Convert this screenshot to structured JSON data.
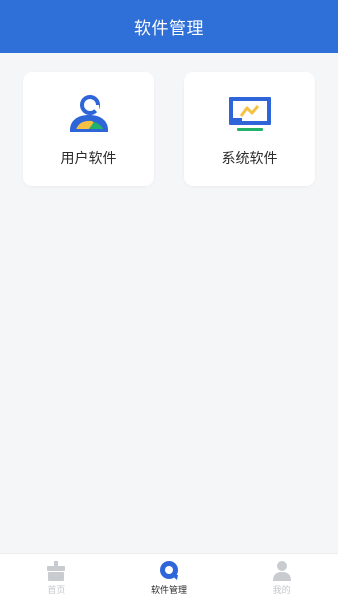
{
  "header": {
    "title": "软件管理"
  },
  "cards": [
    {
      "label": "用户软件",
      "icon": "user-software-icon"
    },
    {
      "label": "系统软件",
      "icon": "system-software-icon"
    }
  ],
  "bottom_nav": {
    "items": [
      {
        "label": "首页",
        "icon": "home-icon",
        "active": false
      },
      {
        "label": "软件管理",
        "icon": "software-management-icon",
        "active": true
      },
      {
        "label": "我的",
        "icon": "profile-icon",
        "active": false
      }
    ]
  },
  "colors": {
    "header": "#2f6fd8",
    "background": "#f5f6f8",
    "accent_blue": "#2e66d9",
    "accent_yellow": "#f5c143",
    "accent_green": "#23b26a",
    "inactive_icon": "#c8cbd0"
  }
}
